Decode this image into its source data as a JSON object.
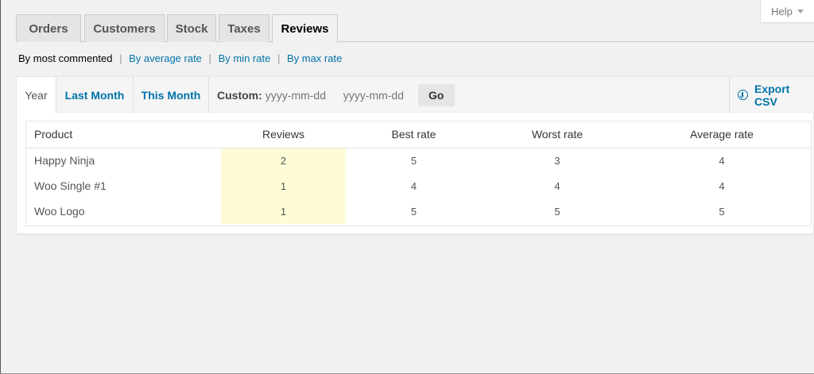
{
  "help": {
    "label": "Help"
  },
  "tabs": [
    {
      "label": "Orders",
      "active": false
    },
    {
      "label": "Customers",
      "active": false
    },
    {
      "label": "Stock",
      "active": false
    },
    {
      "label": "Taxes",
      "active": false
    },
    {
      "label": "Reviews",
      "active": true
    }
  ],
  "subnav": {
    "current": "By most commented",
    "links": [
      "By average rate",
      "By min rate",
      "By max rate"
    ],
    "separator": "|"
  },
  "range": {
    "items": [
      "Year",
      "Last Month",
      "This Month"
    ],
    "active": "Year",
    "custom_label": "Custom:",
    "from_placeholder": "yyyy-mm-dd",
    "to_placeholder": "yyyy-mm-dd",
    "go_label": "Go",
    "export_label": "Export CSV"
  },
  "table": {
    "columns": [
      "Product",
      "Reviews",
      "Best rate",
      "Worst rate",
      "Average rate"
    ],
    "rows": [
      [
        "Happy Ninja",
        "2",
        "5",
        "3",
        "4"
      ],
      [
        "Woo Single #1",
        "1",
        "4",
        "4",
        "4"
      ],
      [
        "Woo Logo",
        "1",
        "5",
        "5",
        "5"
      ]
    ]
  },
  "colors": {
    "link": "#0073aa",
    "highlight": "#fefcd7",
    "background": "#f1f1f1"
  }
}
